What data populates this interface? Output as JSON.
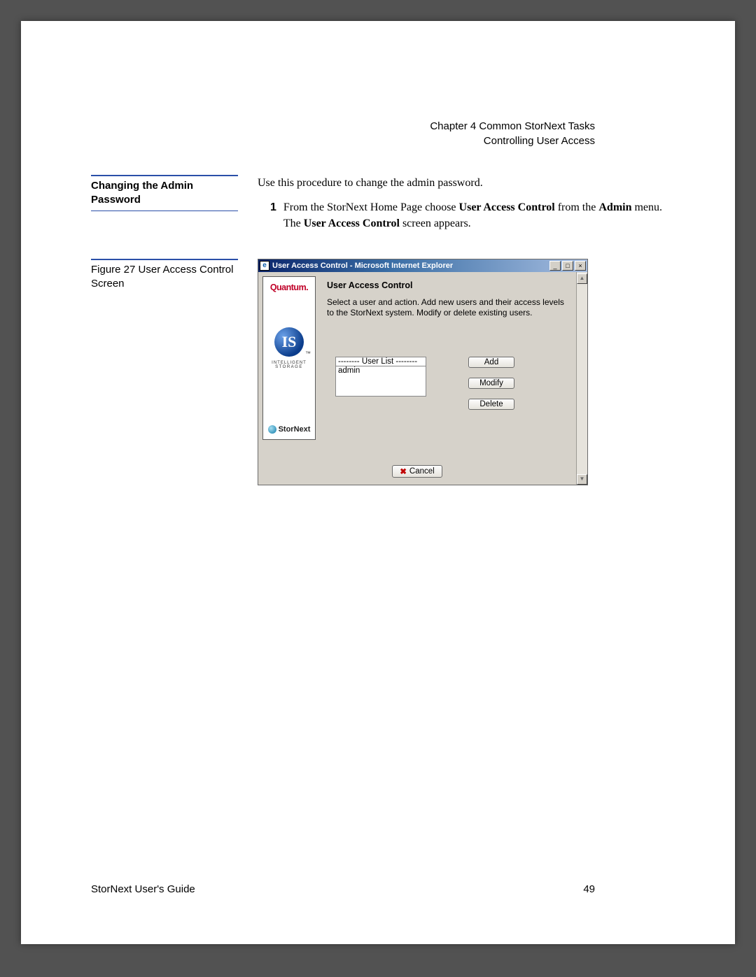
{
  "header": {
    "chapter": "Chapter 4  Common StorNext Tasks",
    "section": "Controlling User Access"
  },
  "sidebar_heading": "Changing the Admin Password",
  "intro": "Use this procedure to change the admin password.",
  "step1": {
    "num": "1",
    "prefix": "From the StorNext Home Page choose ",
    "bold1": "User Access Control",
    "mid1": " from the ",
    "bold2": "Admin",
    "mid2": " menu. The ",
    "bold3": "User Access Control",
    "suffix": " screen appears."
  },
  "figure_caption": "Figure 27  User Access Control Screen",
  "window": {
    "title": "User Access Control - Microsoft Internet Explorer",
    "min": "_",
    "max": "□",
    "close": "×",
    "scroll_up": "▲",
    "scroll_dn": "▼",
    "brand": "Quantum.",
    "is_text": "IS",
    "is_sub1": "INTELLIGENT",
    "is_sub2": "STORAGE",
    "stornext": "StorNext",
    "panel_title": "User Access Control",
    "panel_desc": "Select a user and action. Add new users and their access levels to the StorNext system. Modify or delete existing users.",
    "userlist_label": "-------- User List --------",
    "userlist_entry": "admin",
    "btn_add": "Add",
    "btn_modify": "Modify",
    "btn_delete": "Delete",
    "btn_cancel": "Cancel",
    "x": "✖"
  },
  "footer": {
    "left": "StorNext User's Guide",
    "right": "49"
  }
}
